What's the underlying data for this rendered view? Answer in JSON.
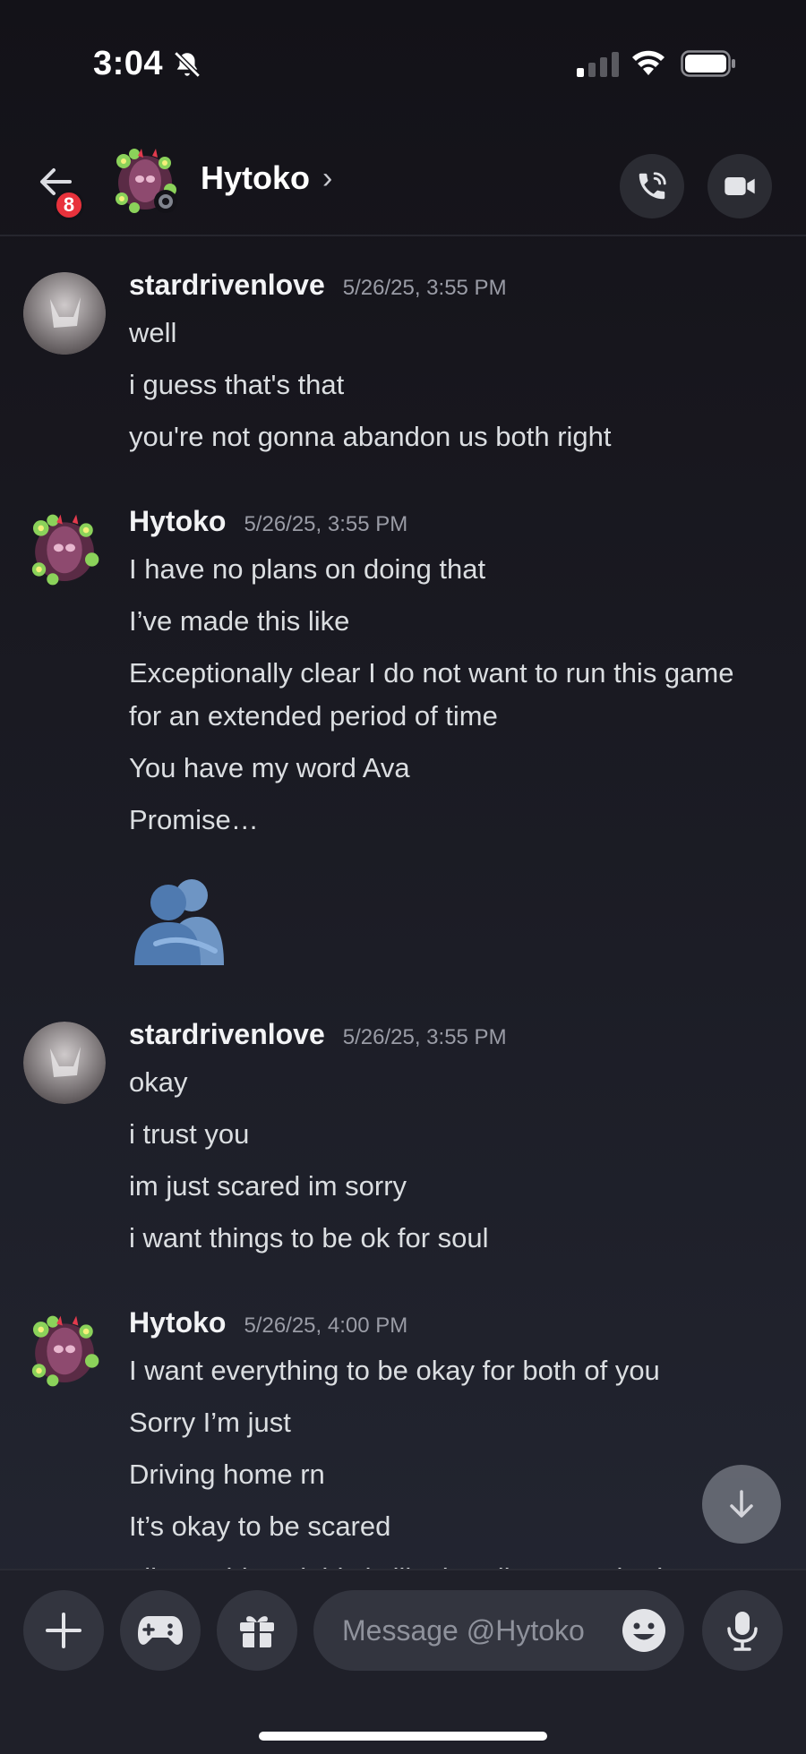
{
  "status_bar": {
    "time": "3:04"
  },
  "header": {
    "back_badge": "8",
    "contact_name": "Hytoko",
    "chevron": "›"
  },
  "messages": [
    {
      "username": "stardrivenlove",
      "timestamp": "5/26/25, 3:55 PM",
      "avatar": "stardrivenlove-avatar",
      "lines": [
        "well",
        "i guess that's that",
        "you're not gonna abandon us both right"
      ]
    },
    {
      "username": "Hytoko",
      "timestamp": "5/26/25, 3:55 PM",
      "avatar": "hytoko-avatar",
      "lines": [
        "I have no plans on doing that",
        "I’ve made this like",
        "Exceptionally clear I do not want to run this game for an extended period of time",
        "You have my word Ava",
        "Promise…"
      ],
      "sticker": "hug-sticker"
    },
    {
      "username": "stardrivenlove",
      "timestamp": "5/26/25, 3:55 PM",
      "avatar": "stardrivenlove-avatar",
      "lines": [
        "okay",
        "i trust you",
        "im just scared im sorry",
        "i want things to be ok for soul"
      ]
    },
    {
      "username": "Hytoko",
      "timestamp": "5/26/25, 4:00 PM",
      "avatar": "hytoko-avatar",
      "lines": [
        "I want everything to be okay for both of you",
        "Sorry I’m just",
        "Driving home rn",
        "It’s okay to be scared",
        "Like I told soul this is like handing somebody"
      ]
    }
  ],
  "composer": {
    "placeholder": "Message @Hytoko"
  },
  "colors": {
    "badge": "#e8323c",
    "status_idle": "#80848e",
    "input_bg": "#33353f"
  }
}
